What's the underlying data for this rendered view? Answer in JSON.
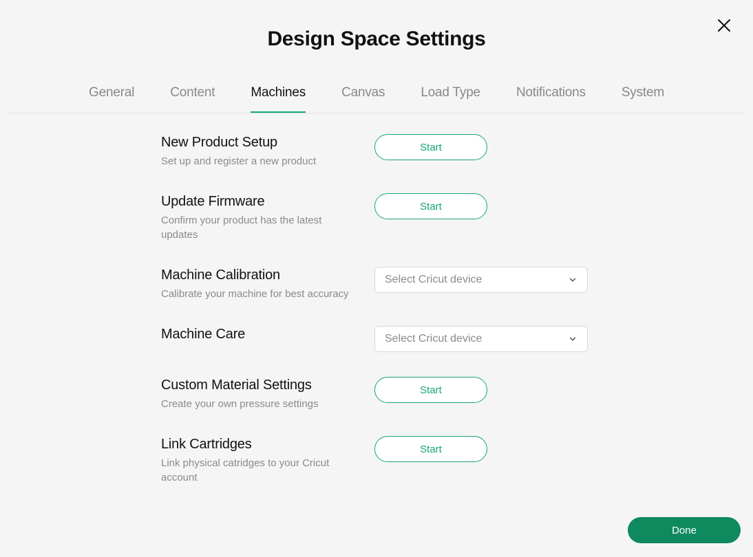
{
  "title": "Design Space Settings",
  "tabs": [
    {
      "label": "General",
      "active": false
    },
    {
      "label": "Content",
      "active": false
    },
    {
      "label": "Machines",
      "active": true
    },
    {
      "label": "Canvas",
      "active": false
    },
    {
      "label": "Load Type",
      "active": false
    },
    {
      "label": "Notifications",
      "active": false
    },
    {
      "label": "System",
      "active": false
    }
  ],
  "rows": {
    "new_product": {
      "title": "New Product Setup",
      "desc": "Set up and register a new product",
      "button": "Start"
    },
    "firmware": {
      "title": "Update Firmware",
      "desc": "Confirm your product has the latest updates",
      "button": "Start"
    },
    "calibration": {
      "title": "Machine Calibration",
      "desc": "Calibrate your machine for best accuracy",
      "placeholder": "Select Cricut device"
    },
    "care": {
      "title": "Machine Care",
      "desc": "",
      "placeholder": "Select Cricut device"
    },
    "custom_material": {
      "title": "Custom Material Settings",
      "desc": "Create your own pressure settings",
      "button": "Start"
    },
    "cartridges": {
      "title": "Link Cartridges",
      "desc": "Link physical catridges to your Cricut account",
      "button": "Start"
    }
  },
  "done_label": "Done",
  "colors": {
    "accent": "#17a673",
    "accent_dark": "#0f8a5f"
  }
}
